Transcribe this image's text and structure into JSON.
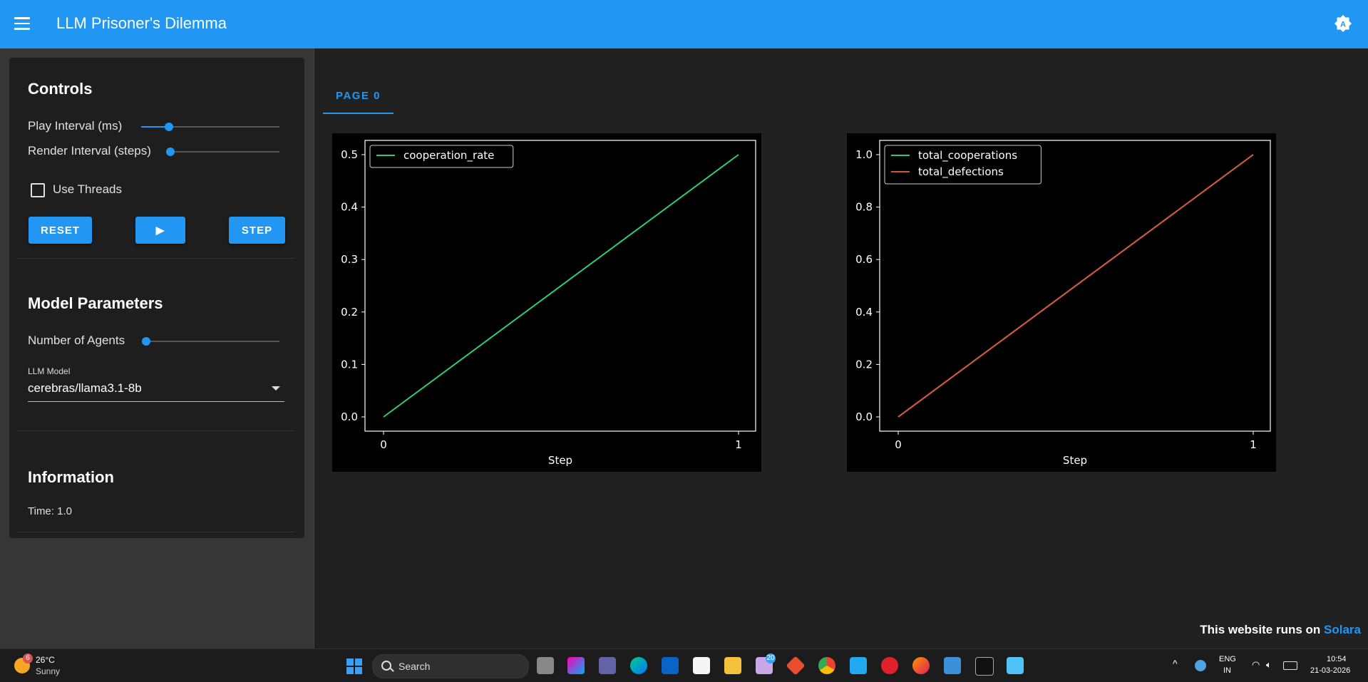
{
  "app": {
    "title": "LLM Prisoner's Dilemma"
  },
  "controls": {
    "title": "Controls",
    "play_interval_label": "Play Interval (ms)",
    "play_interval_level": 0.2,
    "render_interval_label": "Render Interval (steps)",
    "render_interval_level": 0.0,
    "use_threads_label": "Use Threads",
    "use_threads_checked": false,
    "reset_label": "RESET",
    "play_label": "▶",
    "step_label": "STEP"
  },
  "model_params": {
    "title": "Model Parameters",
    "num_agents_label": "Number of Agents",
    "num_agents_level": 0.0,
    "llm_model_label": "LLM Model",
    "llm_model_value": "cerebras/llama3.1-8b"
  },
  "information": {
    "title": "Information",
    "time_text": "Time: 1.0"
  },
  "tabs": [
    {
      "label": "PAGE 0",
      "active": true
    }
  ],
  "chart_data": [
    {
      "type": "line",
      "xlabel": "Step",
      "ylabel": "",
      "x": [
        0,
        1
      ],
      "xticks": [
        "0",
        "1"
      ],
      "yticks": [
        "0.0",
        "0.1",
        "0.2",
        "0.3",
        "0.4",
        "0.5"
      ],
      "ylim": [
        0,
        0.5
      ],
      "legend": "top-left",
      "series": [
        {
          "name": "cooperation_rate",
          "values": [
            0,
            0.5
          ],
          "color": "#2ecc71"
        }
      ]
    },
    {
      "type": "line",
      "xlabel": "Step",
      "ylabel": "",
      "x": [
        0,
        1
      ],
      "xticks": [
        "0",
        "1"
      ],
      "yticks": [
        "0.0",
        "0.2",
        "0.4",
        "0.6",
        "0.8",
        "1.0"
      ],
      "ylim": [
        0,
        1.0
      ],
      "legend": "top-left",
      "series": [
        {
          "name": "total_cooperations",
          "values": [
            0,
            1
          ],
          "color": "#2ecc71"
        },
        {
          "name": "total_defections",
          "values": [
            0,
            1
          ],
          "color": "#d9533a"
        }
      ]
    }
  ],
  "footer": {
    "prefix": "This website runs on ",
    "link_text": "Solara"
  },
  "taskbar": {
    "weather_badge": "6",
    "temperature": "26°C",
    "condition": "Sunny",
    "search_label": "Search",
    "mail_badge": "20",
    "language_top": "ENG",
    "language_bottom": "IN",
    "time": "10:54",
    "date": "21-03-2026"
  },
  "colors": {
    "accent": "#2196f3",
    "background": "#212121",
    "panel": "#1e1e1e"
  }
}
